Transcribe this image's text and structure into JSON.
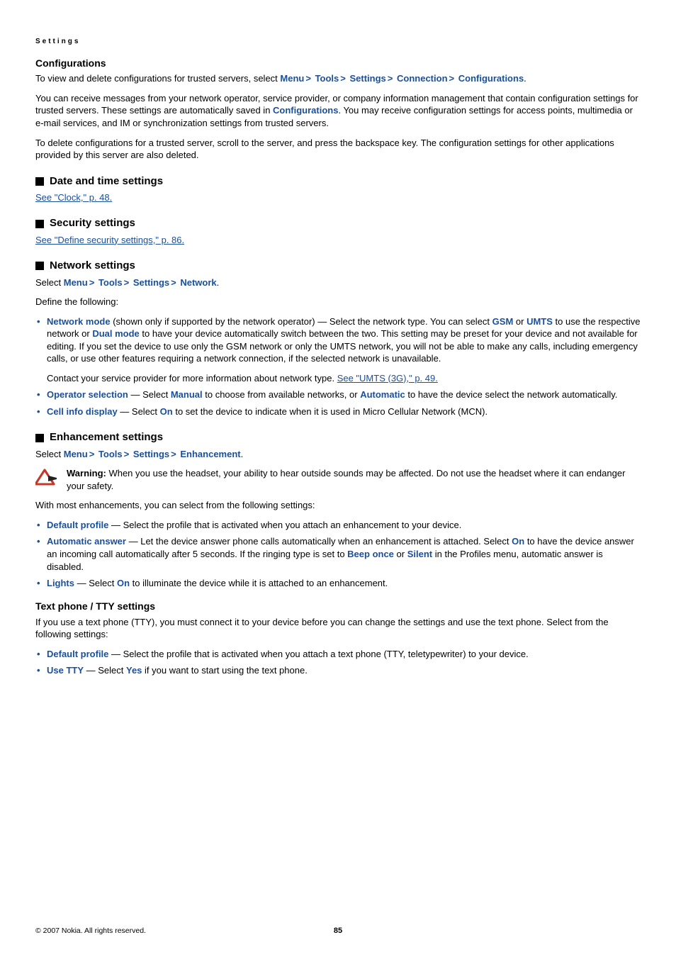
{
  "header": {
    "section": "Settings"
  },
  "configurations": {
    "heading": "Configurations",
    "p1_a": "To view and delete configurations for trusted servers, select ",
    "p1_path": [
      "Menu",
      "Tools",
      "Settings",
      "Connection",
      "Configurations"
    ],
    "p1_end": ".",
    "p2_a": "You can receive messages from your network operator, service provider, or company information management that contain configuration settings for trusted servers. These settings are automatically saved in ",
    "p2_term": "Configurations",
    "p2_b": ". You may receive configuration settings for access points, multimedia or e-mail services, and IM or synchronization settings from trusted servers.",
    "p3": "To delete configurations for a trusted server, scroll to the server, and press the backspace key. The configuration settings for other applications provided by this server are also deleted."
  },
  "date_time": {
    "heading": "Date and time settings",
    "link": "See \"Clock,\" p. 48."
  },
  "security": {
    "heading": "Security settings",
    "link": "See \"Define security settings,\" p. 86."
  },
  "network": {
    "heading": "Network settings",
    "select_a": "Select ",
    "select_path": [
      "Menu",
      "Tools",
      "Settings",
      "Network"
    ],
    "select_end": ".",
    "define": "Define the following:",
    "b1": {
      "label": "Network mode",
      "text_a": " (shown only if supported by the network operator) — Select the network type. You can select ",
      "gsm": "GSM",
      "or": " or ",
      "umts": "UMTS",
      "text_b": " to use the respective network or ",
      "dual": "Dual mode",
      "text_c": " to have your device automatically switch between the two. This setting may be preset for your device and not available for editing. If you set the device to use only the GSM network or only the UMTS network, you will not be able to make any calls, including emergency calls, or use other features requiring a network connection, if the selected network is unavailable.",
      "contact": "Contact your service provider for more information about network type. ",
      "contact_link": "See \"UMTS (3G),\" p. 49."
    },
    "b2": {
      "label": "Operator selection",
      "a": " — Select ",
      "manual": "Manual",
      "b": " to choose from available networks, or ",
      "automatic": "Automatic",
      "c": " to have the device select the network automatically."
    },
    "b3": {
      "label": "Cell info display",
      "a": " — Select ",
      "on": "On",
      "b": " to set the device to indicate when it is used in Micro Cellular Network (MCN)."
    }
  },
  "enhancement": {
    "heading": "Enhancement settings",
    "select_a": "Select ",
    "select_path": [
      "Menu",
      "Tools",
      "Settings",
      "Enhancement"
    ],
    "select_end": ".",
    "warning_label": "Warning:  ",
    "warning_text": "When you use the headset, your ability to hear outside sounds may be affected. Do not use the headset where it can endanger your safety.",
    "intro": "With most enhancements, you can select from the following settings:",
    "b1": {
      "label": "Default profile",
      "a": " — Select the profile that is activated when you attach an enhancement to your device."
    },
    "b2": {
      "label": "Automatic answer",
      "a": " — Let the device answer phone calls automatically when an enhancement is attached. Select ",
      "on": "On",
      "b": " to have the device answer an incoming call automatically after 5 seconds. If the ringing type is set to ",
      "beep": "Beep once",
      "or": " or ",
      "silent": "Silent",
      "c": " in the Profiles menu, automatic answer is disabled."
    },
    "b3": {
      "label": "Lights",
      "a": " — Select ",
      "on": "On",
      "b": " to illuminate the device while it is attached to an enhancement."
    }
  },
  "tty": {
    "heading": "Text phone / TTY settings",
    "intro": "If you use a text phone (TTY), you must connect it to your device before you can change the settings and use the text phone. Select from the following settings:",
    "b1": {
      "label": "Default profile",
      "a": " — Select the profile that is activated when you attach a text phone (TTY, teletypewriter) to your device."
    },
    "b2": {
      "label": "Use TTY",
      "a": " — Select ",
      "yes": "Yes",
      "b": " if you want to start using the text phone."
    }
  },
  "footer": {
    "copyright": "© 2007 Nokia. All rights reserved.",
    "page": "85"
  }
}
